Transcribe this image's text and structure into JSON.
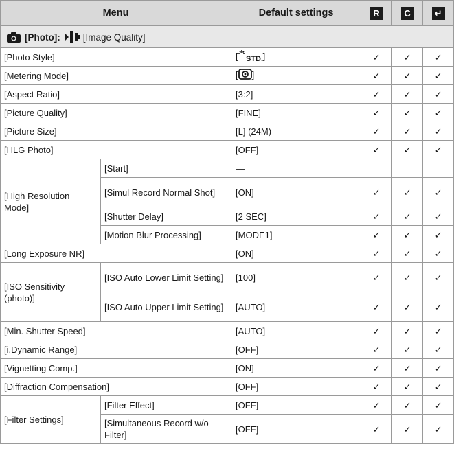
{
  "header": {
    "menu": "Menu",
    "default_settings": "Default settings",
    "icon_r": "R",
    "icon_c": "C",
    "icon_save": "↵"
  },
  "section": {
    "photo_label": "[Photo]:",
    "tab_label": "[Image Quality]",
    "icons": [
      "camera-icon",
      "image-quality-icon"
    ]
  },
  "rows": [
    {
      "menu": "[Photo Style]",
      "default": "[",
      "default_tail": "]",
      "default_icon": "photo-style-standard-icon",
      "default_icon_text": "STD.",
      "checks": [
        "✓",
        "✓",
        "✓"
      ]
    },
    {
      "menu": "[Metering Mode]",
      "default": "[",
      "default_tail": "]",
      "default_icon": "multi-metering-icon",
      "checks": [
        "✓",
        "✓",
        "✓"
      ]
    },
    {
      "menu": "[Aspect Ratio]",
      "default": "[3:2]",
      "checks": [
        "✓",
        "✓",
        "✓"
      ]
    },
    {
      "menu": "[Picture Quality]",
      "default": "[FINE]",
      "checks": [
        "✓",
        "✓",
        "✓"
      ]
    },
    {
      "menu": "[Picture Size]",
      "default": "[L] (24M)",
      "checks": [
        "✓",
        "✓",
        "✓"
      ]
    },
    {
      "menu": "[HLG Photo]",
      "default": "[OFF]",
      "checks": [
        "✓",
        "✓",
        "✓"
      ]
    }
  ],
  "high_res": {
    "menu": "[High Resolution Mode]",
    "sub": [
      {
        "label": "[Start]",
        "default": "—",
        "checks": [
          "",
          "",
          ""
        ]
      },
      {
        "label": "[Simul Record Normal Shot]",
        "default": "[ON]",
        "checks": [
          "✓",
          "✓",
          "✓"
        ]
      },
      {
        "label": "[Shutter Delay]",
        "default": "[2 SEC]",
        "checks": [
          "✓",
          "✓",
          "✓"
        ]
      },
      {
        "label": "[Motion Blur Processing]",
        "default": "[MODE1]",
        "checks": [
          "✓",
          "✓",
          "✓"
        ]
      }
    ]
  },
  "long_exposure": {
    "menu": "[Long Exposure NR]",
    "default": "[ON]",
    "checks": [
      "✓",
      "✓",
      "✓"
    ]
  },
  "iso": {
    "menu": "[ISO Sensitivity (photo)]",
    "sub": [
      {
        "label": "[ISO Auto Lower Limit Setting]",
        "default": "[100]",
        "checks": [
          "✓",
          "✓",
          "✓"
        ]
      },
      {
        "label": "[ISO Auto Upper Limit Setting]",
        "default": "[AUTO]",
        "checks": [
          "✓",
          "✓",
          "✓"
        ]
      }
    ]
  },
  "rows2": [
    {
      "menu": "[Min. Shutter Speed]",
      "default": "[AUTO]",
      "checks": [
        "✓",
        "✓",
        "✓"
      ]
    },
    {
      "menu": "[i.Dynamic Range]",
      "default": "[OFF]",
      "checks": [
        "✓",
        "✓",
        "✓"
      ]
    },
    {
      "menu": "[Vignetting Comp.]",
      "default": "[ON]",
      "checks": [
        "✓",
        "✓",
        "✓"
      ]
    },
    {
      "menu": "[Diffraction Compensation]",
      "default": "[OFF]",
      "checks": [
        "✓",
        "✓",
        "✓"
      ]
    }
  ],
  "filter": {
    "menu": "[Filter Settings]",
    "sub": [
      {
        "label": "[Filter Effect]",
        "default": "[OFF]",
        "checks": [
          "✓",
          "✓",
          "✓"
        ]
      },
      {
        "label": "[Simultaneous Record w/o Filter]",
        "default": "[OFF]",
        "checks": [
          "✓",
          "✓",
          "✓"
        ]
      }
    ]
  }
}
